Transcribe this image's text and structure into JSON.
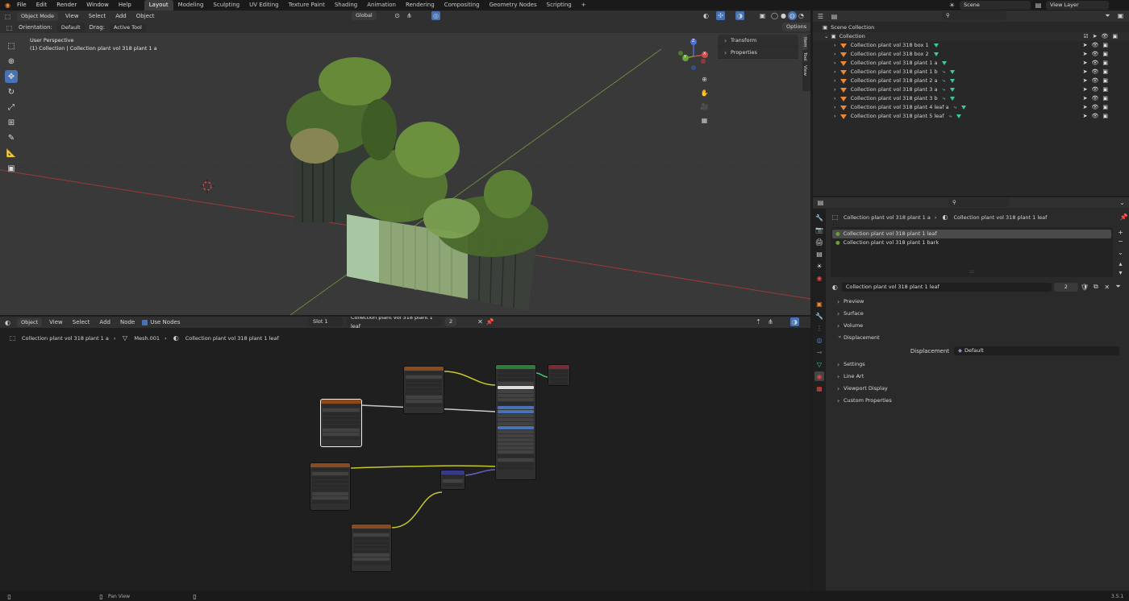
{
  "topbar": {
    "menu": [
      "File",
      "Edit",
      "Render",
      "Window",
      "Help"
    ],
    "workspaces": [
      "Layout",
      "Modeling",
      "Sculpting",
      "UV Editing",
      "Texture Paint",
      "Shading",
      "Animation",
      "Rendering",
      "Compositing",
      "Geometry Nodes",
      "Scripting"
    ],
    "active_workspace": "Layout",
    "add_tab": "+",
    "scene": "Scene",
    "view_layer": "View Layer"
  },
  "viewport": {
    "mode": "Object Mode",
    "menus": [
      "View",
      "Select",
      "Add",
      "Object"
    ],
    "transform_orientation": "Global",
    "orientation_label": "Orientation:",
    "orientation_value": "Default",
    "drag_label": "Drag:",
    "drag_value": "Active Tool",
    "options": "Options",
    "overlay_title": "User Perspective",
    "overlay_subtitle": "(1) Collection | Collection plant vol 318 plant 1 a",
    "n_panel": [
      "Transform",
      "Properties"
    ],
    "side_tabs": [
      "Item",
      "Tool",
      "View"
    ],
    "gizmo_axes": {
      "x": "X",
      "y": "Y",
      "z": "Z"
    }
  },
  "outliner": {
    "scene_collection": "Scene Collection",
    "collection": "Collection",
    "items": [
      "Collection plant vol 318 box 1",
      "Collection plant vol 318 box 2",
      "Collection plant vol 318 plant 1 a",
      "Collection plant vol 318 plant 1 b",
      "Collection plant vol 318 plant 2 a",
      "Collection plant vol 318 plant 3 a",
      "Collection plant vol 318 plant 3 b",
      "Collection plant vol 318 plant 4 leaf a",
      "Collection plant vol 318 plant 5 leaf"
    ]
  },
  "properties": {
    "breadcrumb_object": "Collection plant vol 318 plant 1 a",
    "breadcrumb_material": "Collection plant vol 318 plant 1 leaf",
    "slots": [
      "Collection plant vol 318 plant 1 leaf",
      "Collection plant vol 318 plant 1 bark"
    ],
    "material_name": "Collection plant vol 318 plant 1 leaf",
    "user_count": "2",
    "panels": [
      "Preview",
      "Surface",
      "Volume",
      "Displacement",
      "Settings",
      "Line Art",
      "Viewport Display",
      "Custom Properties"
    ],
    "displacement_label": "Displacement",
    "displacement_value": "Default",
    "dots": ":::"
  },
  "node_editor": {
    "object": "Object",
    "menus": [
      "View",
      "Select",
      "Add",
      "Node"
    ],
    "use_nodes": "Use Nodes",
    "slot": "Slot 1",
    "material": "Collection plant vol 318 plant 1 leaf",
    "user_count": "2",
    "breadcrumb": [
      "Collection plant vol 318 plant 1 a",
      "Mesh.001",
      "Collection plant vol 318 plant 1 leaf"
    ]
  },
  "statusbar": {
    "pan_view": "Pan View",
    "version": "3.5.1"
  },
  "colors": {
    "accent": "#4772b3",
    "orange": "#e8893a",
    "teal": "#3cc9a0",
    "node_texture_header": "#8a4a1e",
    "node_bsdf_header": "#2d7d3a",
    "node_output_header": "#7a2a35",
    "node_vector_header": "#3a3a8a"
  }
}
